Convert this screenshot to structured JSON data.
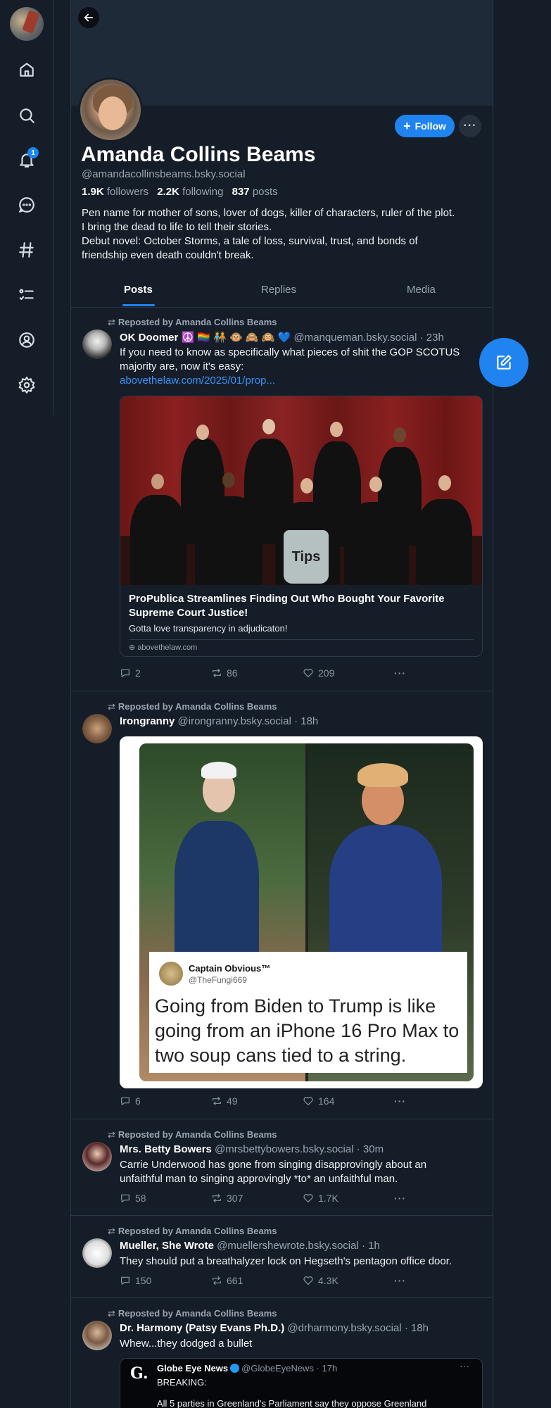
{
  "nav": {
    "notifications_badge": "1"
  },
  "profile": {
    "name": "Amanda Collins Beams",
    "handle": "@amandacollinsbeams.bsky.social",
    "followers_count": "1.9K",
    "followers_label": "followers",
    "following_count": "2.2K",
    "following_label": "following",
    "posts_count": "837",
    "posts_label": "posts",
    "bio_lines": [
      "Pen name for mother of sons, lover of dogs, killer of characters, ruler of the plot.",
      "I bring the dead to life to tell their stories.",
      "Debut novel: October Storms, a tale of loss, survival, trust, and bonds of",
      "friendship even death couldn't break."
    ],
    "follow_label": "Follow",
    "more_label": "···"
  },
  "tabs": [
    "Posts",
    "Replies",
    "Media"
  ],
  "feed": [
    {
      "repost_label": "Reposted by Amanda Collins Beams",
      "author": "OK Doomer ☮️ 🏳️‍🌈 🧑‍🤝‍🧑 🐵 🙈 🙉 💙",
      "handle_time": "@manqueman.bsky.social · 23h",
      "text_lines": [
        "If you need to know as specifically what pieces of shit the GOP SCOTUS",
        "majority are, now it's easy:"
      ],
      "link": "abovethelaw.com/2025/01/prop...",
      "card": {
        "title": "ProPublica Streamlines Finding Out Who Bought Your Favorite Supreme Court Justice!",
        "desc": "Gotta love transparency in adjudicaton!",
        "domain": "abovethelaw.com",
        "jar_label": "Tips"
      },
      "replies": "2",
      "reposts": "86",
      "likes": "209"
    },
    {
      "repost_label": "Reposted by Amanda Collins Beams",
      "author": "Irongranny",
      "handle_time": "@irongranny.bsky.social · 18h",
      "meme": {
        "name": "Captain Obvious™",
        "handle": "@TheFungi669",
        "text": "Going from Biden to Trump is like going from an iPhone 16 Pro Max to two soup cans tied to a string."
      },
      "replies": "6",
      "reposts": "49",
      "likes": "164"
    },
    {
      "repost_label": "Reposted by Amanda Collins Beams",
      "author": "Mrs. Betty Bowers",
      "handle_time": "@mrsbettybowers.bsky.social · 30m",
      "text_lines": [
        "Carrie Underwood has gone from singing disapprovingly about an",
        "unfaithful man to singing approvingly *to* an unfaithful man."
      ],
      "replies": "58",
      "reposts": "307",
      "likes": "1.7K"
    },
    {
      "repost_label": "Reposted by Amanda Collins Beams",
      "author": "Mueller, She Wrote",
      "handle_time": "@muellershewrote.bsky.social · 1h",
      "text_lines": [
        "They should put a breathalyzer lock on Hegseth's pentagon office door."
      ],
      "replies": "150",
      "reposts": "661",
      "likes": "4.3K"
    },
    {
      "repost_label": "Reposted by Amanda Collins Beams",
      "author": "Dr. Harmony (Patsy Evans Ph.D.)",
      "handle_time": "@drharmony.bsky.social · 18h",
      "text_lines": [
        "Whew...they dodged a bullet"
      ],
      "quote": {
        "logo": "G.",
        "name": "Globe Eye News",
        "handle_time": "@GlobeEyeNews · 17h",
        "line1": "BREAKING:",
        "line2": "All 5 parties in Greenland's Parliament say they oppose Greenland"
      }
    }
  ],
  "colors": {
    "background": "#151d28",
    "accent": "#1f83f0",
    "link": "#3b93f7",
    "muted": "#9aa5b2"
  }
}
